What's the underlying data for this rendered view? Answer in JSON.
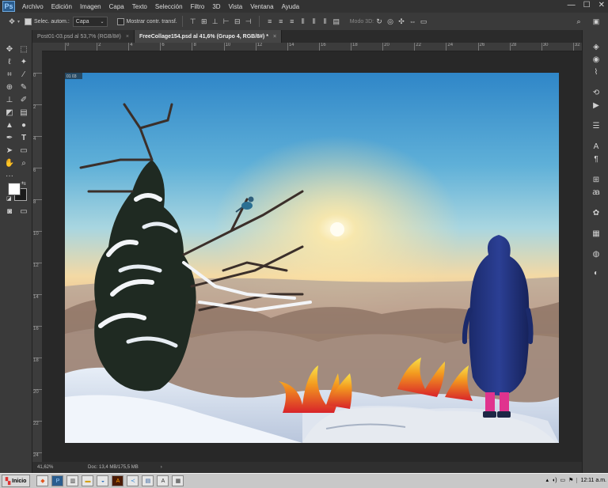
{
  "app": {
    "logo": "Ps"
  },
  "menu": [
    "Archivo",
    "Edición",
    "Imagen",
    "Capa",
    "Texto",
    "Selección",
    "Filtro",
    "3D",
    "Vista",
    "Ventana",
    "Ayuda"
  ],
  "window_controls": {
    "minimize": "—",
    "maximize": "☐",
    "close": "✕"
  },
  "options": {
    "auto_select_label": "Selec. autom.:",
    "auto_select_checked": true,
    "layer_select": "Capa",
    "show_transform_label": "Mostrar contr. transf.",
    "show_transform_checked": false,
    "mode3d_label": "Modo 3D:"
  },
  "tabs": [
    {
      "label": "Post01-03.psd al 53,7% (RGB/8#)",
      "close": "×",
      "active": false
    },
    {
      "label": "FreeCollage154.psd al 41,6% (Grupo 4, RGB/8#) *",
      "close": "×",
      "active": true
    }
  ],
  "rulers": {
    "top": [
      "0",
      "2",
      "4",
      "6",
      "8",
      "10",
      "12",
      "14",
      "16",
      "18",
      "20",
      "22",
      "24",
      "26",
      "28",
      "30",
      "32"
    ],
    "left": [
      "0",
      "2",
      "4",
      "6",
      "8",
      "10",
      "12",
      "14",
      "16",
      "18",
      "20",
      "22",
      "24"
    ]
  },
  "canvas": {
    "corner_label": "01 03"
  },
  "status": {
    "zoom": "41,62%",
    "doc": "Doc: 13,4 MB/175,5 MB",
    "arrow": "›"
  },
  "colors": {
    "foreground": "#ffffff",
    "background": "#1a1a1a",
    "accent": "#2a5d8f"
  },
  "taskbar": {
    "start_label": "Inicio",
    "icons": [
      "brave-icon",
      "file-explorer-icon",
      "photoshop-icon",
      "paint-icon",
      "folder-icon",
      "illustrator-icon",
      "vscode-icon",
      "word-icon",
      "text-icon",
      "app-icon"
    ],
    "clock": "12:11 a.m."
  },
  "left_tools": [
    "move-icon",
    "marquee-icon",
    "lasso-icon",
    "magic-wand-icon",
    "crop-icon",
    "eyedropper-icon",
    "healing-icon",
    "brush-icon",
    "stamp-icon",
    "history-brush-icon",
    "eraser-icon",
    "gradient-icon",
    "blur-icon",
    "dodge-icon",
    "pen-icon",
    "type-icon",
    "path-select-icon",
    "shape-icon",
    "hand-icon",
    "zoom-icon",
    "more-icon"
  ],
  "right_tools": [
    "layers-icon",
    "channels-icon",
    "paths-icon",
    "history-icon",
    "actions-icon",
    "properties-icon",
    "character-icon",
    "paragraph-icon",
    "clone-source-icon",
    "glyphs-icon",
    "brush-presets-icon",
    "swatches-icon",
    "navigator-icon",
    "adjustments-icon"
  ]
}
